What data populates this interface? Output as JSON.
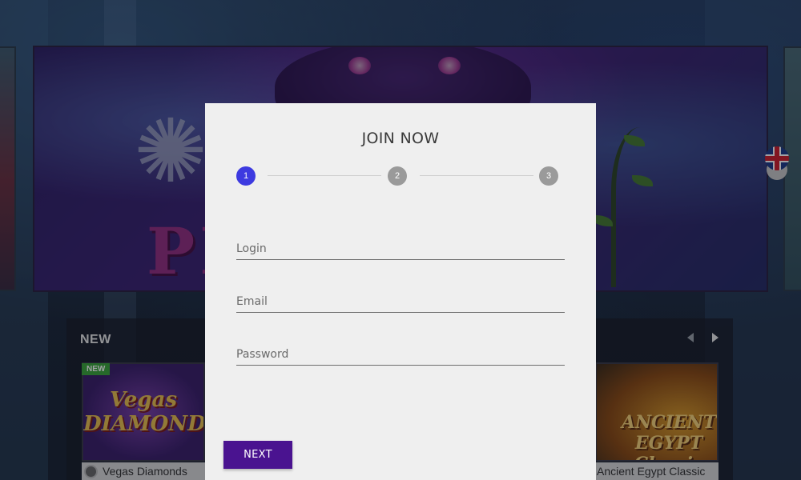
{
  "banner": {
    "logo_text": "PI        TS"
  },
  "language": {
    "flag_icon": "uk-flag-icon"
  },
  "games": {
    "section_title": "NEW",
    "prev_icon": "chevron-left-icon",
    "next_icon": "chevron-right-icon",
    "tiles": [
      {
        "title": "Vegas Diamonds",
        "art_text": "Vegas\nDIAMONDS",
        "badge": "NEW"
      },
      {
        "title": "Ancient Egypt Classic",
        "art_text": "ANCIENT EGYPT Classic"
      }
    ]
  },
  "modal": {
    "title": "JOIN NOW",
    "steps": [
      "1",
      "2",
      "3"
    ],
    "active_step": 1,
    "fields": {
      "login_placeholder": "Login",
      "email_placeholder": "Email",
      "password_placeholder": "Password"
    },
    "next_label": "NEXT"
  },
  "colors": {
    "active_step": "#3d3ae0",
    "inactive_step": "#9a9a9a",
    "primary_button": "#4a1390",
    "modal_background": "#efefef"
  }
}
